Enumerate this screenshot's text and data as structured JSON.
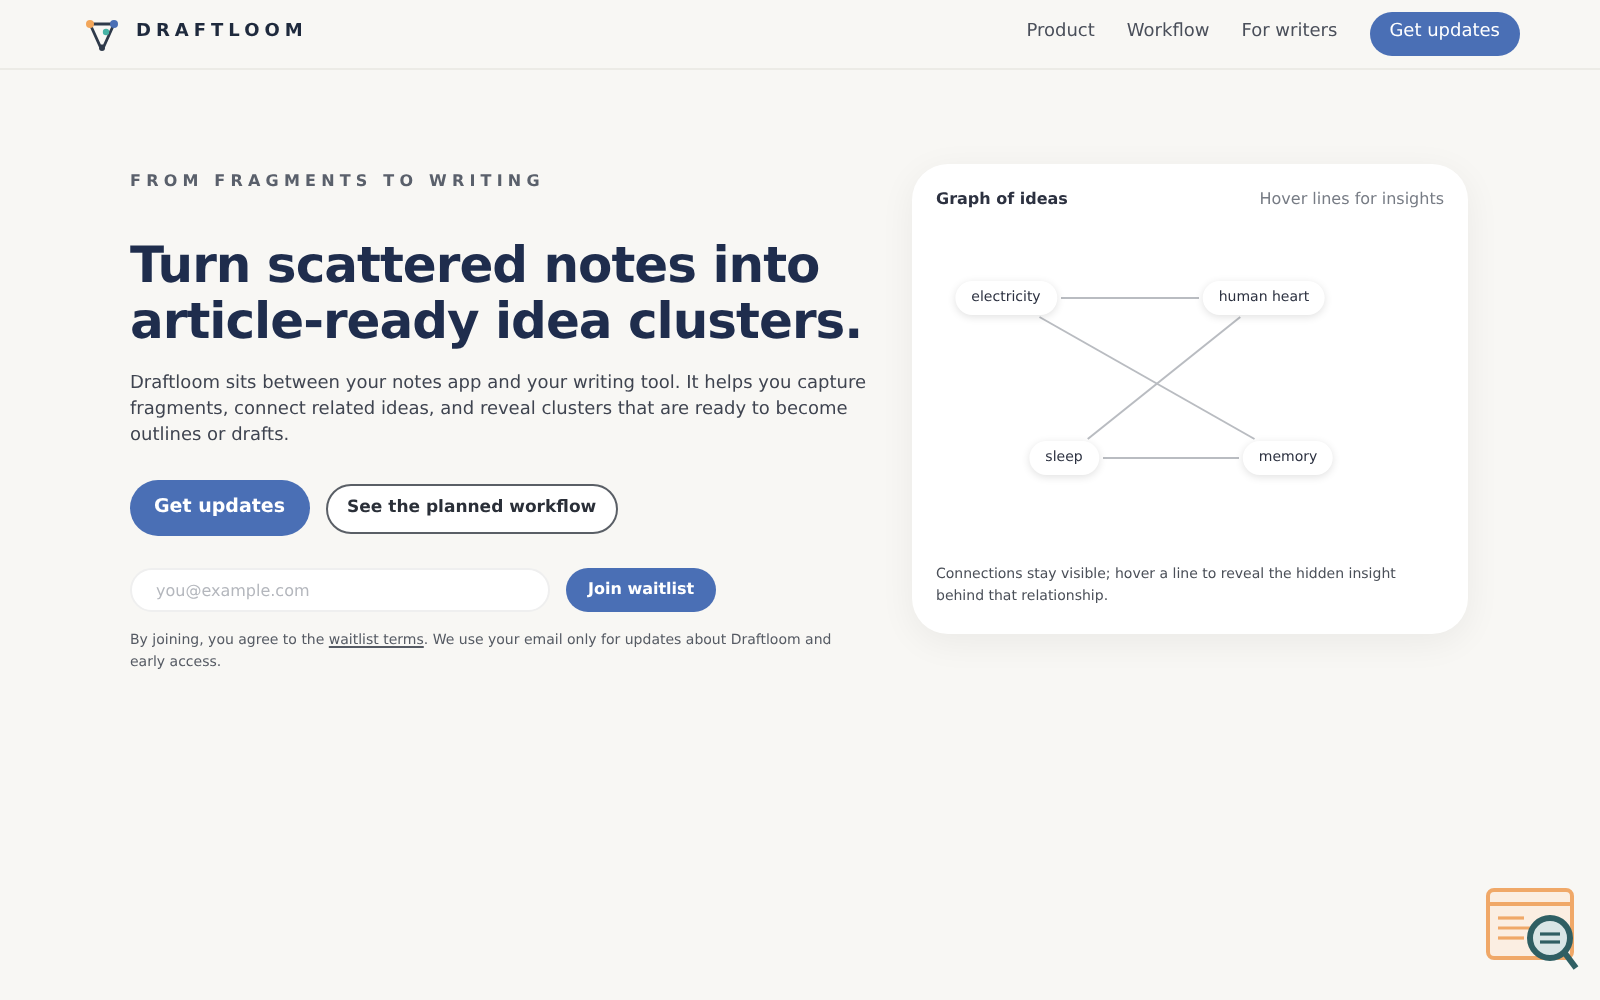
{
  "brand": {
    "name": "DRAFTLOOM"
  },
  "nav": {
    "links": [
      "Product",
      "Workflow",
      "For writers"
    ],
    "cta": "Get updates"
  },
  "hero": {
    "eyebrow": "FROM FRAGMENTS TO WRITING",
    "title": "Turn scattered notes into article-ready idea clusters.",
    "lead": "Draftloom sits between your notes app and your writing tool. It helps you capture fragments, connect related ideas, and reveal clusters that are ready to become outlines or drafts.",
    "primary": "Get updates",
    "secondary": "See the planned workflow"
  },
  "waitlist": {
    "placeholder": "you@example.com",
    "button": "Join waitlist",
    "note_before": "By joining, you agree to the ",
    "note_link": "waitlist terms",
    "note_after": ". We use your email only for updates about Draftloom and early access."
  },
  "graph": {
    "title": "Graph of ideas",
    "hint": "Hover lines for insights",
    "nodes": [
      "electricity",
      "human heart",
      "sleep",
      "memory"
    ],
    "caption": "Connections stay visible; hover a line to reveal the hidden insight behind that relationship."
  }
}
